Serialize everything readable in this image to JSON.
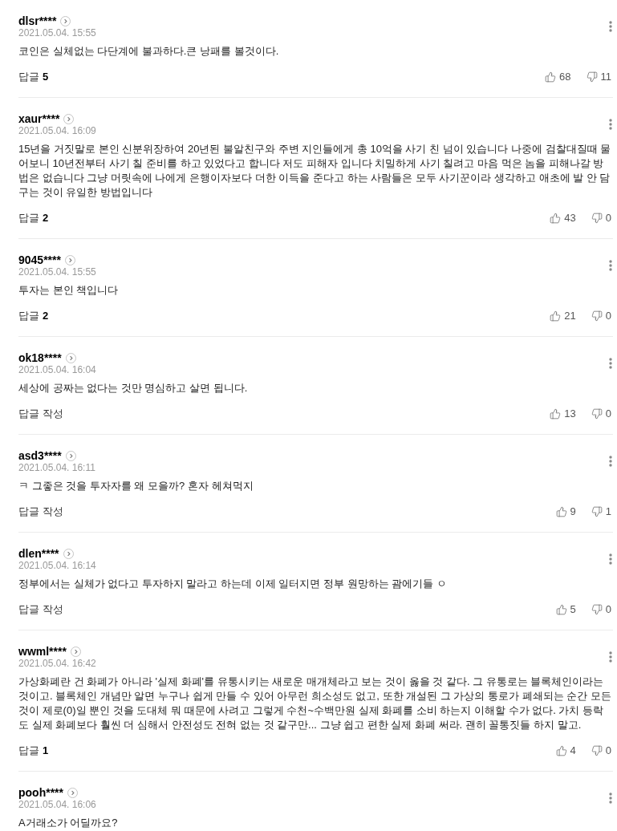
{
  "comments": [
    {
      "username": "dlsr****",
      "date": "2021.05.04. 15:55",
      "text": "코인은 실체없는 다단계에 불과하다.큰 낭패를 볼것이다.",
      "reply_label": "답글",
      "reply_count": "5",
      "likes": "68",
      "dislikes": "11"
    },
    {
      "username": "xaur****",
      "date": "2021.05.04. 16:09",
      "text": "15년을 거짓말로 본인 신분위장하여 20년된 불알친구와 주변 지인들에게 총 10억을 사기 친 넘이 있습니다 나중에 검찰대질때 물어보니 10년전부터 사기 칠 준비를 하고 있었다고 합니다 저도 피해자 입니다 치밀하게 사기 칠려고 마음 먹은 놈을 피해나갈 방법은 없습니다 그냥 머릿속에 나에게 은행이자보다 더한 이득을 준다고 하는 사람들은 모두 사기꾼이라 생각하고 애초에 발 안 담구는 것이 유일한 방법입니다",
      "reply_label": "답글",
      "reply_count": "2",
      "likes": "43",
      "dislikes": "0"
    },
    {
      "username": "9045****",
      "date": "2021.05.04. 15:55",
      "text": "투자는 본인 책입니다",
      "reply_label": "답글",
      "reply_count": "2",
      "likes": "21",
      "dislikes": "0"
    },
    {
      "username": "ok18****",
      "date": "2021.05.04. 16:04",
      "text": "세상에 공짜는 없다는 것만 명심하고 살면 됩니다.",
      "reply_label": "답글 작성",
      "likes": "13",
      "dislikes": "0"
    },
    {
      "username": "asd3****",
      "date": "2021.05.04. 16:11",
      "text": "ㅋ 그좋은 것을 투자자를 왜 모을까? 혼자 헤쳐먹지",
      "reply_label": "답글 작성",
      "likes": "9",
      "dislikes": "1"
    },
    {
      "username": "dlen****",
      "date": "2021.05.04. 16:14",
      "text": "정부에서는 실체가 없다고 투자하지 말라고 하는데 이제 일터지면 정부 원망하는 괌에기들 ㅇ",
      "reply_label": "답글 작성",
      "likes": "5",
      "dislikes": "0"
    },
    {
      "username": "wwml****",
      "date": "2021.05.04. 16:42",
      "text": "가상화폐란 건 화폐가 아니라 '실제 화폐'를 유통시키는 새로운 매개체라고 보는 것이 옳을 것 같다. 그 유통로는 블록체인이라는 것이고. 블록체인 개념만 알면 누구나 쉽게 만들 수 있어 아무런 희소성도 없고, 또한 개설된 그 가상의 통로가 폐쇄되는 순간 모든 것이 제로(0)일 뿐인 것을 도대체 뭐 때문에 사려고 그렇게 수천~수백만원 실제 화폐를 소비 하는지 이해할 수가 없다. 가치 등락도 실제 화폐보다 훨씬 더 심해서 안전성도 전혀 없는 것 같구만... 그냥 쉽고 편한 실제 화폐 써라. 괜히 꼴통짓들 하지 말고.",
      "reply_label": "답글",
      "reply_count": "1",
      "likes": "4",
      "dislikes": "0"
    },
    {
      "username": "pooh****",
      "date": "2021.05.04. 16:06",
      "text": "A거래소가 어딜까요?"
    }
  ]
}
